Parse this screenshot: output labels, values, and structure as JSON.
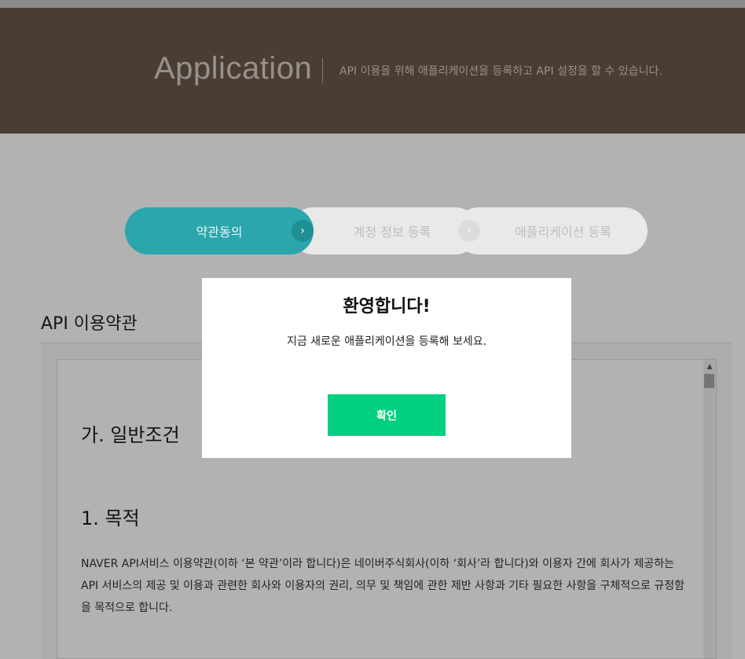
{
  "header": {
    "title": "Application",
    "description": "API 이용을 위해 애플리케이션을 등록하고 API 설정을 할 수 있습니다."
  },
  "steps": [
    {
      "label": "약관동의",
      "state": "active"
    },
    {
      "label": "계정 정보 등록",
      "state": "inactive"
    },
    {
      "label": "애플리케이션 등록",
      "state": "inactive"
    }
  ],
  "step_arrow_glyph": "›",
  "terms": {
    "title": "API 이용약관",
    "section_heading": "가. 일반조건",
    "article_heading": "1. 목적",
    "paragraph": "NAVER API서비스 이용약관(이하 ‘본 약관’이라 합니다)은 네이버주식회사(이하 ‘회사’라 합니다)와 이용자 간에 회사가 제공하는 API 서비스의 제공 및 이용과 관련한 회사와 이용자의 권리, 의무 및 책임에 관한 제반 사항과 기타 필요한 사항을 구체적으로 규정함을 목적으로 합니다."
  },
  "modal": {
    "title": "환영합니다!",
    "message": "지금 새로운 애플리케이션을 등록해 보세요.",
    "confirm_label": "확인"
  },
  "colors": {
    "header_bg": "#6b5849",
    "step_active": "#2aa6ac",
    "step_inactive": "#e9e9e9",
    "confirm_button": "#03cf81"
  }
}
